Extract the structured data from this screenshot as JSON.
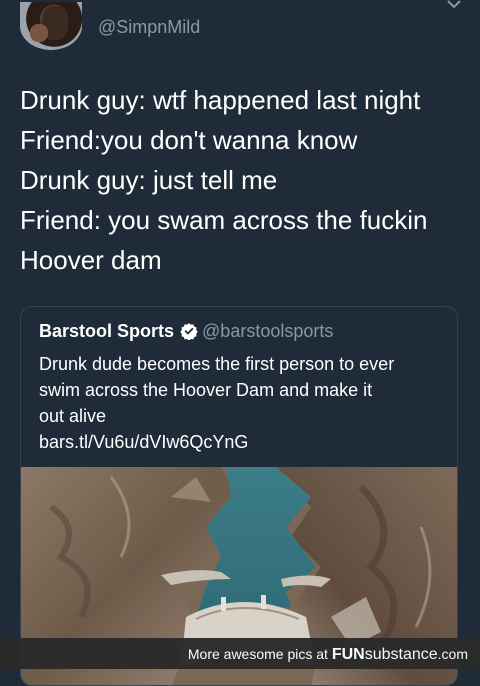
{
  "tweet": {
    "handle": "@SimpnMild",
    "lines": [
      "Drunk guy: wtf happened last night",
      "Friend:you don't wanna know",
      "Drunk guy: just tell me",
      "Friend: you swam across the fuckin",
      "Hoover dam"
    ]
  },
  "quote": {
    "name": "Barstool Sports",
    "username": "@barstoolsports",
    "verified": true,
    "lines": [
      "Drunk dude becomes the first person to ever",
      "swim across the Hoover Dam and make it",
      "out alive"
    ],
    "link": "bars.tl/Vu6u/dVIw6QcYnG",
    "image_subject": "aerial view of Hoover Dam and canyon"
  },
  "footer": {
    "prefix": "More awesome pics at",
    "brand_bold": "FUN",
    "brand_rest": "substance",
    "suffix": ".com"
  },
  "colors": {
    "background": "#1f2b38",
    "secondary_text": "#8899a6",
    "border": "#38444d",
    "verified": "#ffffff"
  },
  "icons": [
    "avatar",
    "chevron-down-icon",
    "verified-badge-icon"
  ]
}
